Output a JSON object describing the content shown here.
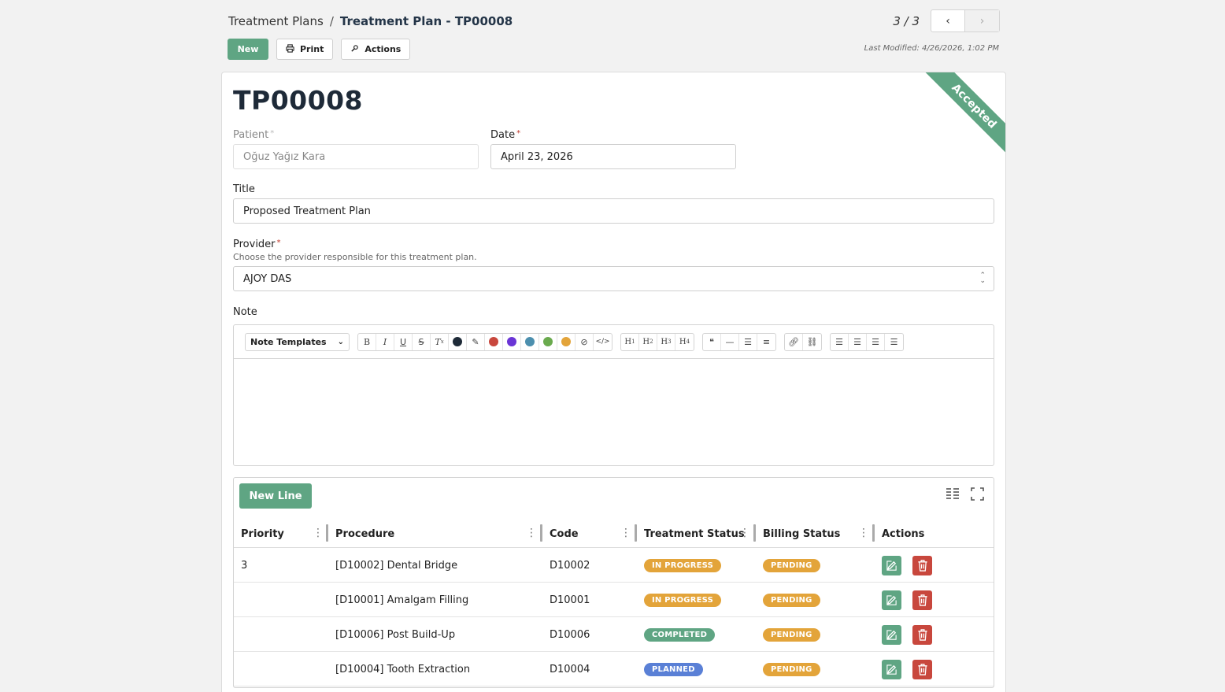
{
  "breadcrumb": {
    "root": "Treatment Plans",
    "separator": "/",
    "current": "Treatment Plan - TP00008"
  },
  "pager": {
    "count": "3 / 3",
    "prev": "‹",
    "next": "›"
  },
  "toolbar": {
    "new_label": "New",
    "print_label": "Print",
    "actions_label": "Actions"
  },
  "last_modified": "Last Modified: 4/26/2026, 1:02 PM",
  "record": {
    "title": "TP00008",
    "status_ribbon": "Accepted",
    "patient": {
      "label": "Patient",
      "value": "Oğuz Yağız Kara"
    },
    "date": {
      "label": "Date",
      "value": "April 23, 2026"
    },
    "title_field": {
      "label": "Title",
      "value": "Proposed Treatment Plan"
    },
    "provider": {
      "label": "Provider",
      "help": "Choose the provider responsible for this treatment plan.",
      "value": "AJOY DAS"
    },
    "note": {
      "label": "Note",
      "templates_label": "Note Templates"
    }
  },
  "colors": {
    "accent": "#5fa583",
    "danger": "#c8473d",
    "in_progress": "#e3a43a",
    "pending": "#e3a43a",
    "completed": "#5fa583",
    "planned": "#5a80d6",
    "swatches": [
      "#1e2a38",
      "#c8473d",
      "#6a35d6",
      "#4c8fae",
      "#6aaa4e",
      "#e3a43a"
    ]
  },
  "lines": {
    "new_line_label": "New Line",
    "columns": [
      "Priority",
      "Procedure",
      "Code",
      "Treatment Status",
      "Billing Status",
      "Actions"
    ],
    "rows": [
      {
        "priority": "3",
        "procedure": "[D10002] Dental Bridge",
        "code": "D10002",
        "treatment_status": "IN PROGRESS",
        "billing_status": "PENDING"
      },
      {
        "priority": "",
        "procedure": "[D10001] Amalgam Filling",
        "code": "D10001",
        "treatment_status": "IN PROGRESS",
        "billing_status": "PENDING"
      },
      {
        "priority": "",
        "procedure": "[D10006] Post Build-Up",
        "code": "D10006",
        "treatment_status": "COMPLETED",
        "billing_status": "PENDING"
      },
      {
        "priority": "",
        "procedure": "[D10004] Tooth Extraction",
        "code": "D10004",
        "treatment_status": "PLANNED",
        "billing_status": "PENDING"
      }
    ]
  }
}
